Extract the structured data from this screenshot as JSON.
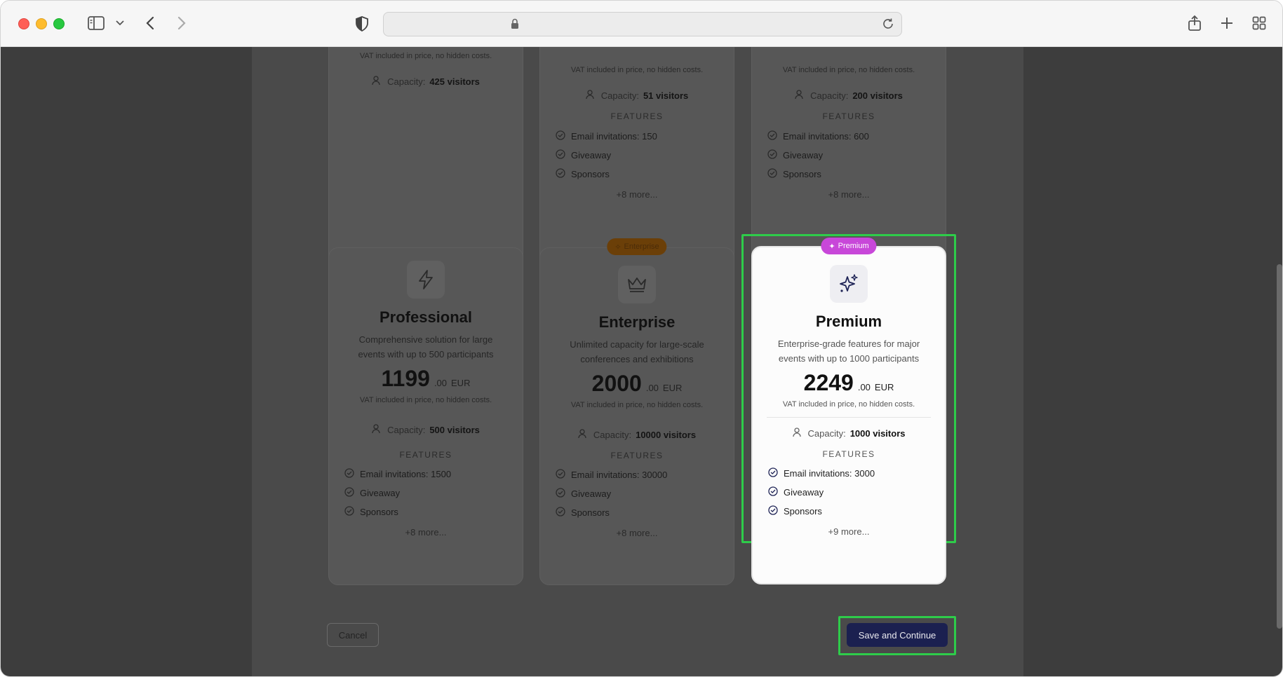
{
  "browser": {
    "icons": [
      "sidebar-icon",
      "chevron-down-icon",
      "back-icon",
      "forward-icon",
      "shield-icon",
      "lock-icon",
      "reload-icon",
      "share-icon",
      "plus-icon",
      "tabs-grid-icon"
    ]
  },
  "common": {
    "vat_note": "VAT included in price, no hidden costs.",
    "capacity_label": "Capacity:",
    "features_title": "FEATURES"
  },
  "top_cards": [
    {
      "capacity": "425 visitors"
    },
    {
      "capacity": "51 visitors",
      "features": [
        "Email invitations: 150",
        "Giveaway",
        "Sponsors"
      ],
      "more": "+8 more..."
    },
    {
      "capacity": "200 visitors",
      "features": [
        "Email invitations: 600",
        "Giveaway",
        "Sponsors"
      ],
      "more": "+8 more..."
    }
  ],
  "plans": [
    {
      "name": "Professional",
      "icon": "lightning-icon",
      "description": "Comprehensive solution for large events with up to 500 participants",
      "price": "1199",
      "cents": ".00",
      "currency": "EUR",
      "capacity": "500 visitors",
      "features": [
        "Email invitations: 1500",
        "Giveaway",
        "Sponsors"
      ],
      "more": "+8 more..."
    },
    {
      "name": "Enterprise",
      "badge": "Enterprise",
      "icon": "crown-icon",
      "description": "Unlimited capacity for large-scale conferences and exhibitions",
      "price": "2000",
      "cents": ".00",
      "currency": "EUR",
      "capacity": "10000 visitors",
      "features": [
        "Email invitations: 30000",
        "Giveaway",
        "Sponsors"
      ],
      "more": "+8 more..."
    },
    {
      "name": "Premium",
      "badge": "Premium",
      "icon": "sparkles-icon",
      "description": "Enterprise-grade features for major events with up to 1000 participants",
      "price": "2249",
      "cents": ".00",
      "currency": "EUR",
      "capacity": "1000 visitors",
      "features": [
        "Email invitations: 3000",
        "Giveaway",
        "Sponsors"
      ],
      "more": "+9 more...",
      "selected": true
    }
  ],
  "actions": {
    "cancel_label": "Cancel",
    "save_label": "Save and Continue"
  },
  "colors": {
    "highlight": "#2ecc4a",
    "primary_button": "#1b2050",
    "premium_badge": "#c847d9",
    "enterprise_badge": "#e07a10"
  }
}
